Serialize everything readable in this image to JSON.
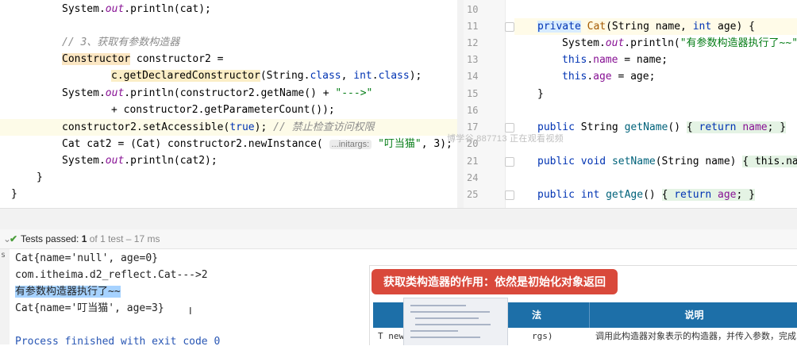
{
  "left_editor": {
    "lines": {
      "l1_pre": "System.",
      "l1_out": "out",
      "l1_post": ".println(cat);",
      "l2_comment": "// 3、获取有参数构造器",
      "l3_type": "Constructor",
      "l3_post": " constructor2 =",
      "l4_call": "c.getDeclaredConstructor",
      "l4_a": "(String.",
      "l4_kw1": "class",
      "l4_b": ", ",
      "l4_kw2": "int",
      "l4_c": ".",
      "l4_kw3": "class",
      "l4_d": ");",
      "l5_pre": "System.",
      "l5_out": "out",
      "l5_mid": ".println(constructor2.getName() + ",
      "l5_str": "\"--->\"",
      "l6_text": "+ constructor2.getParameterCount());",
      "l7_pre": "constructor2.setAccessible(",
      "l7_kw": "true",
      "l7_post": "); ",
      "l7_comment": "// 禁止检查访问权限",
      "l8_pre": "Cat cat2 = (Cat) constructor2.newInstance( ",
      "l8_hint": "...initargs:",
      "l8_str": "\"叮当猫\"",
      "l8_post": ", 3);",
      "l9_pre": "System.",
      "l9_out": "out",
      "l9_post": ".println(cat2);",
      "l10": "}",
      "l11": "}"
    }
  },
  "right_editor": {
    "line_numbers": [
      "10",
      "11",
      "12",
      "13",
      "14",
      "15",
      "16",
      "17",
      "20",
      "21",
      "24",
      "25"
    ],
    "code": {
      "r11_kw": "private",
      "r11_type": "Cat",
      "r11_a": "(String name, ",
      "r11_int": "int",
      "r11_b": " age) {",
      "r12_pre": "System.",
      "r12_out": "out",
      "r12_mid": ".println(",
      "r12_str": "\"有参数构造器执行了~~\"",
      "r13_kw": "this",
      "r13_dot": ".",
      "r13_fld": "name",
      "r13_post": " = name;",
      "r14_kw": "this",
      "r14_dot": ".",
      "r14_fld": "age",
      "r14_post": " = age;",
      "r15": "}",
      "r17_kw": "public",
      "r17_a": " String ",
      "r17_fn": "getName",
      "r17_b": "() ",
      "r17_body_open": "{ ",
      "r17_ret": "return",
      "r17_fld": " name",
      "r17_body_close": "; }",
      "r21_kw": "public",
      "r21_void": " void ",
      "r21_fn": "setName",
      "r21_b": "(String name) ",
      "r21_body": "{ this.na",
      "r25_kw": "public",
      "r25_int": " int ",
      "r25_fn": "getAge",
      "r25_b": "() ",
      "r25_body_open": "{ ",
      "r25_ret": "return",
      "r25_fld": " age",
      "r25_body_close": "; }"
    }
  },
  "watermark": "博学谷 887713 正在观看视频",
  "tests_bar": {
    "check": "✔",
    "label": "Tests passed:",
    "count": "1",
    "of": "of 1 test",
    "time": "– 17 ms"
  },
  "console": {
    "gutter_char": "s",
    "lines": [
      "Cat{name='null', age=0}",
      "com.itheima.d2_reflect.Cat--->2",
      "有参数构造器执行了~~",
      "Cat{name='叮当猫', age=3}",
      "",
      "Process finished with exit code 0"
    ],
    "cursor": "I"
  },
  "overlay": {
    "banner": "获取类构造器的作用：依然是初始化对象返回",
    "col_left_fragment": "法",
    "col_desc": "说明",
    "row_left": "T new",
    "row_mid": "rgs)",
    "row_desc": "调用此构造器对象表示的构造器，并传入参数，完成"
  },
  "colors": {
    "banner_bg": "#d9493b",
    "table_head_bg": "#1d6fa8",
    "keyword": "#0033b3",
    "string": "#067d17",
    "comment": "#8c8c8c",
    "selection": "#a6d2ff",
    "tests_check": "#4a9d3a"
  }
}
